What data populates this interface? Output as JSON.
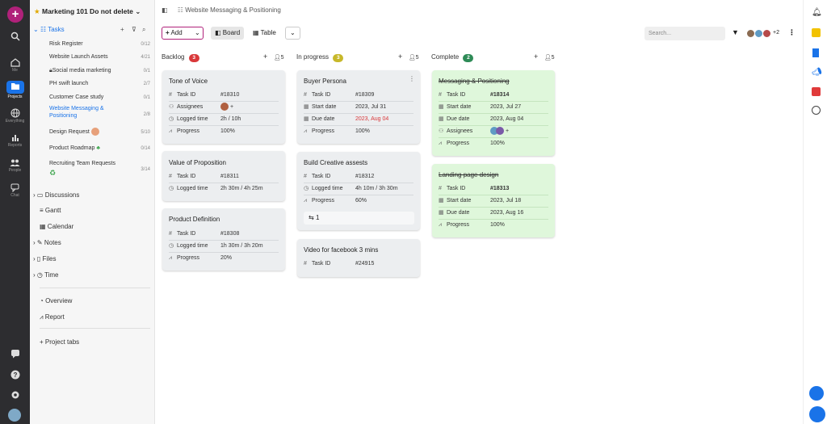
{
  "workspace": {
    "title": "Marketing 101 Do not delete"
  },
  "rail": {
    "items": [
      {
        "label": "Me"
      },
      {
        "label": "Projects"
      },
      {
        "label": "Everything"
      },
      {
        "label": "Reports"
      },
      {
        "label": "People"
      },
      {
        "label": "Chat"
      }
    ]
  },
  "sidebar": {
    "tasks_label": "Tasks",
    "tree": [
      {
        "label": "Risk Register",
        "count": "0/12"
      },
      {
        "label": "Website Launch Assets",
        "count": "4/21"
      },
      {
        "label": "Social media marketing",
        "count": "0/1"
      },
      {
        "label": "PH swift launch",
        "count": "2/7"
      },
      {
        "label": "Customer Case study",
        "count": "0/1"
      },
      {
        "label": "Website Messaging & Positioning",
        "count": "2/8"
      },
      {
        "label": "Design Request",
        "count": "5/10"
      },
      {
        "label": "Product Roadmap",
        "count": "0/14"
      },
      {
        "label": "Recruiting Team Requests",
        "count": "3/14"
      }
    ],
    "sections": [
      {
        "label": "Discussions"
      },
      {
        "label": "Gantt"
      },
      {
        "label": "Calendar"
      },
      {
        "label": "Notes"
      },
      {
        "label": "Files"
      },
      {
        "label": "Time"
      }
    ],
    "bottom": [
      {
        "label": "Overview"
      },
      {
        "label": "Report"
      }
    ],
    "project_tabs": "Project tabs"
  },
  "header": {
    "breadcrumb": "Website Messaging & Positioning"
  },
  "toolbar": {
    "add": "Add",
    "board": "Board",
    "table": "Table",
    "search_placeholder": "Search...",
    "avatar_more": "+2"
  },
  "columns": [
    {
      "title": "Backlog",
      "count": "3",
      "members": "5",
      "color": "#d9383a",
      "cards": [
        {
          "title": "Tone of Voice",
          "fields": [
            {
              "k": "Task ID",
              "v": "#18310"
            },
            {
              "k": "Assignees",
              "v": ""
            },
            {
              "k": "Logged time",
              "v": "2h / 10h"
            },
            {
              "k": "Progress",
              "v": "100%"
            }
          ]
        },
        {
          "title": "Value of Proposition",
          "fields": [
            {
              "k": "Task ID",
              "v": "#18311"
            },
            {
              "k": "Logged time",
              "v": "2h 30m / 4h 25m"
            }
          ]
        },
        {
          "title": "Product Definition",
          "fields": [
            {
              "k": "Task ID",
              "v": "#18308"
            },
            {
              "k": "Logged time",
              "v": "1h 30m / 3h 20m"
            },
            {
              "k": "Progress",
              "v": "20%"
            }
          ]
        }
      ]
    },
    {
      "title": "In progress",
      "count": "3",
      "members": "5",
      "color": "#c7b82a",
      "cards": [
        {
          "title": "Buyer Persona",
          "fields": [
            {
              "k": "Task ID",
              "v": "#18309"
            },
            {
              "k": "Start date",
              "v": "2023, Jul 31"
            },
            {
              "k": "Due date",
              "v": "2023, Aug 04"
            },
            {
              "k": "Progress",
              "v": "100%"
            }
          ]
        },
        {
          "title": "Build Creative assests",
          "fields": [
            {
              "k": "Task ID",
              "v": "#18312"
            },
            {
              "k": "Logged time",
              "v": "4h 10m / 3h 30m"
            },
            {
              "k": "Progress",
              "v": "60%"
            }
          ],
          "subtasks": "1"
        },
        {
          "title": "Video for facebook 3 mins",
          "fields": [
            {
              "k": "Task ID",
              "v": "#24915"
            }
          ]
        }
      ]
    },
    {
      "title": "Complete",
      "count": "2",
      "members": "5",
      "color": "#2e8b57",
      "cards": [
        {
          "title": "Messaging & Positioning",
          "fields": [
            {
              "k": "Task ID",
              "v": "#18314"
            },
            {
              "k": "Start date",
              "v": "2023, Jul 27"
            },
            {
              "k": "Due date",
              "v": "2023, Aug 04"
            },
            {
              "k": "Assignees",
              "v": ""
            },
            {
              "k": "Progress",
              "v": "100%"
            }
          ]
        },
        {
          "title": "Landing page design",
          "fields": [
            {
              "k": "Task ID",
              "v": "#18313"
            },
            {
              "k": "Start date",
              "v": "2023, Jul 18"
            },
            {
              "k": "Due date",
              "v": "2023, Aug 16"
            },
            {
              "k": "Progress",
              "v": "100%"
            }
          ]
        }
      ]
    }
  ]
}
